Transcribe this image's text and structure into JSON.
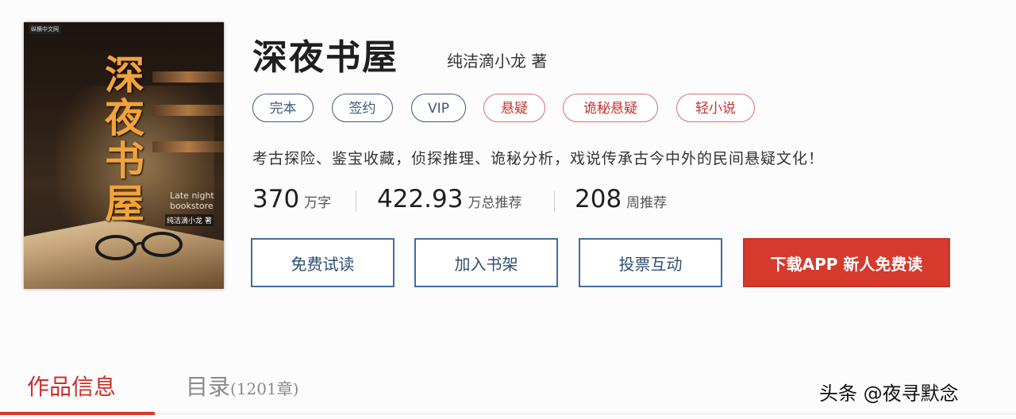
{
  "book": {
    "title": "深夜书屋",
    "author": "纯洁滴小龙 著",
    "cover": {
      "publisher": "纵横中文网",
      "title": "深夜书屋",
      "english": "Late night bookstore",
      "author": "纯洁滴小龙 著"
    },
    "tags": [
      {
        "label": "完本",
        "color": "#3d5a80"
      },
      {
        "label": "签约",
        "color": "#3d5a80"
      },
      {
        "label": "VIP",
        "color": "#3d5a80"
      },
      {
        "label": "悬疑",
        "color": "#c9302c"
      },
      {
        "label": "诡秘悬疑",
        "color": "#c9302c"
      },
      {
        "label": "轻小说",
        "color": "#c9302c"
      }
    ],
    "description": "考古探险、鉴宝收藏，侦探推理、诡秘分析，戏说传承古今中外的民间悬疑文化！",
    "stats": [
      {
        "value": "370",
        "unit": "万字"
      },
      {
        "value": "422.93",
        "unit": "万总推荐"
      },
      {
        "value": "208",
        "unit": "周推荐"
      }
    ]
  },
  "actions": {
    "read_free": "免费试读",
    "add_shelf": "加入书架",
    "vote": "投票互动",
    "download_app": "下载APP 新人免费读"
  },
  "tabs": {
    "info": "作品信息",
    "catalog": "目录",
    "catalog_count": "(1201章)"
  },
  "watermark": "头条 @夜寻默念",
  "colors": {
    "accent": "#d53a2d",
    "tag_blue": "#3d5a80",
    "button_border": "#3d6ea0"
  }
}
